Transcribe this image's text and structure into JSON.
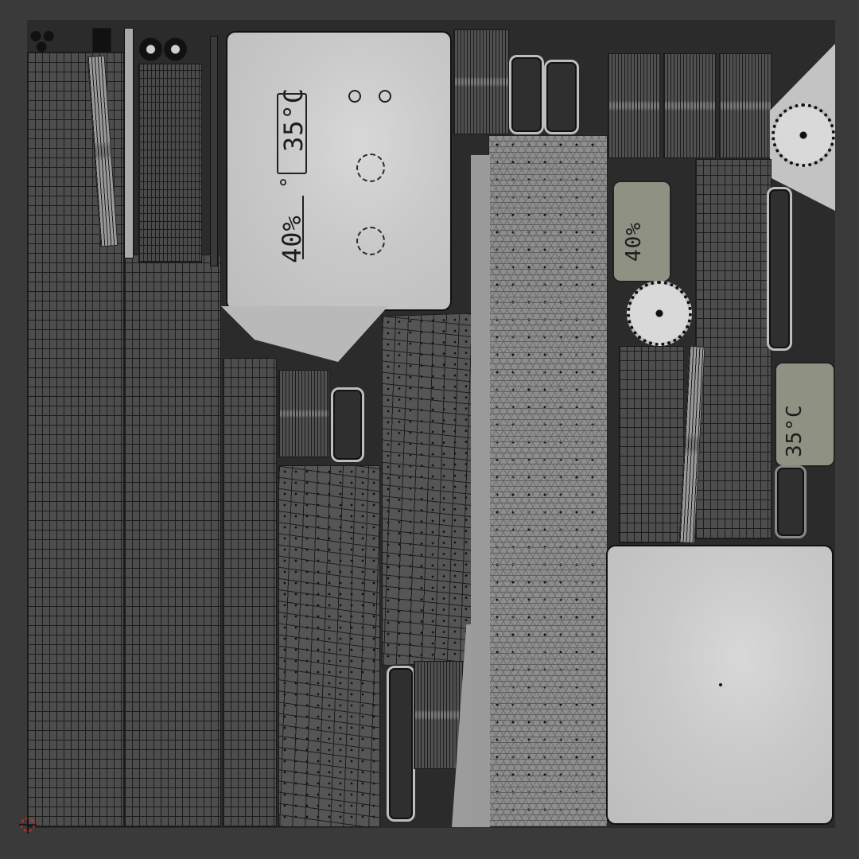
{
  "texture_labels": {
    "main_temperature": "35°C",
    "main_humidity": "40%",
    "main_degree_mark": "°",
    "side_humidity": "40%",
    "side_temperature": "35°C"
  },
  "colors": {
    "background": "#3a3a3a",
    "texture_base": "#2b2b2b",
    "mesh_gray": "#4d4d4d",
    "panel_light": "#c9c9c9",
    "panel_olive": "#8f9282",
    "cursor_red": "#cc2b2b"
  },
  "icons": {
    "cursor": "2d-cursor-icon"
  }
}
